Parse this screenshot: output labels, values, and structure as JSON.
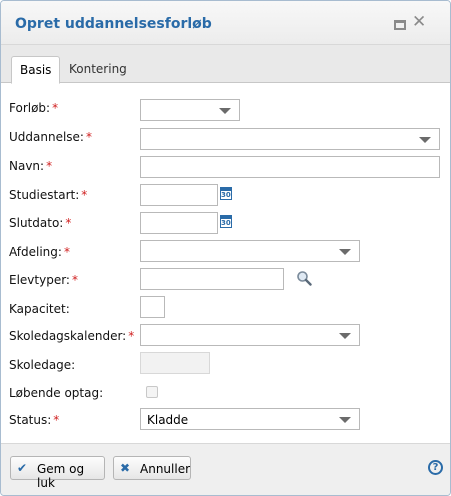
{
  "dialog": {
    "title": "Opret uddannelsesforløb",
    "maximize_icon": "maximize-icon",
    "close_icon": "close-icon",
    "close_glyph": "✕"
  },
  "tabs": [
    {
      "label": "Basis",
      "active": true
    },
    {
      "label": "Kontering",
      "active": false
    }
  ],
  "form": {
    "required_marker": "*",
    "fields": {
      "forloeb": {
        "label": "Forløb:",
        "required": true,
        "value": ""
      },
      "uddannelse": {
        "label": "Uddannelse:",
        "required": true,
        "value": ""
      },
      "navn": {
        "label": "Navn:",
        "required": true,
        "value": ""
      },
      "studiestart": {
        "label": "Studiestart:",
        "required": true,
        "value": ""
      },
      "slutdato": {
        "label": "Slutdato:",
        "required": true,
        "value": ""
      },
      "afdeling": {
        "label": "Afdeling:",
        "required": true,
        "value": ""
      },
      "elevtyper": {
        "label": "Elevtyper:",
        "required": true,
        "value": ""
      },
      "kapacitet": {
        "label": "Kapacitet:",
        "required": false,
        "value": ""
      },
      "skoledagskalender": {
        "label": "Skoledagskalender:",
        "required": true,
        "value": ""
      },
      "skoledage": {
        "label": "Skoledage:",
        "required": false,
        "value": ""
      },
      "loebende_optag": {
        "label": "Løbende optag:",
        "required": false,
        "checked": false
      },
      "status": {
        "label": "Status:",
        "required": true,
        "value": "Kladde"
      }
    },
    "calendar_icon_text": "30"
  },
  "footer": {
    "save_label": "Gem og luk",
    "save_icon": "✔",
    "cancel_label": "Annuller",
    "cancel_icon": "✖",
    "help_icon_text": "?"
  },
  "colors": {
    "accent": "#2a6ba8",
    "required": "#d02020"
  }
}
